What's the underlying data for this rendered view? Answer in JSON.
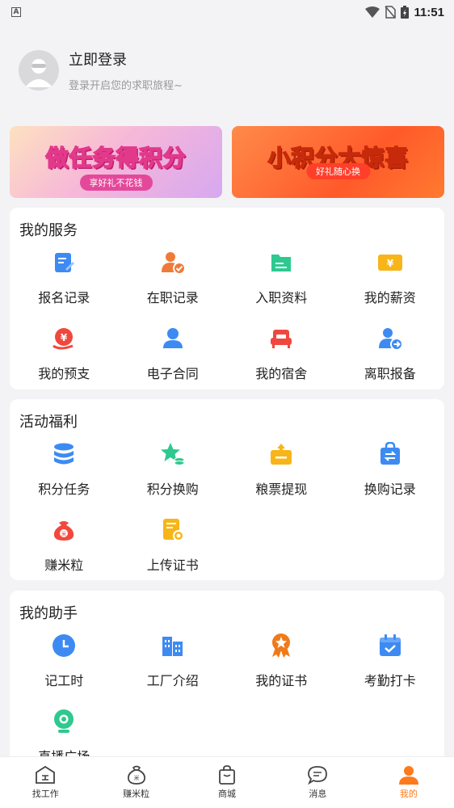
{
  "status_bar": {
    "time": "11:51",
    "left_icon_letter": "A"
  },
  "profile": {
    "title": "立即登录",
    "subtitle": "登录开启您的求职旅程~"
  },
  "banners": [
    {
      "title": "做任务得积分",
      "pill": "享好礼不花钱"
    },
    {
      "title": "小积分大惊喜",
      "pill": "好礼随心换"
    }
  ],
  "services": {
    "title": "我的服务",
    "items": [
      {
        "label": "报名记录",
        "icon": "signup-record-icon"
      },
      {
        "label": "在职记录",
        "icon": "employment-record-icon"
      },
      {
        "label": "入职资料",
        "icon": "onboarding-docs-icon"
      },
      {
        "label": "我的薪资",
        "icon": "salary-icon"
      },
      {
        "label": "我的预支",
        "icon": "advance-pay-icon"
      },
      {
        "label": "电子合同",
        "icon": "e-contract-icon"
      },
      {
        "label": "我的宿舍",
        "icon": "dorm-icon"
      },
      {
        "label": "离职报备",
        "icon": "resignation-icon"
      }
    ]
  },
  "welfare": {
    "title": "活动福利",
    "items": [
      {
        "label": "积分任务",
        "icon": "points-task-icon"
      },
      {
        "label": "积分换购",
        "icon": "points-exchange-icon"
      },
      {
        "label": "粮票提现",
        "icon": "voucher-withdraw-icon"
      },
      {
        "label": "换购记录",
        "icon": "exchange-record-icon"
      },
      {
        "label": "赚米粒",
        "icon": "earn-rice-icon"
      },
      {
        "label": "上传证书",
        "icon": "upload-certificate-icon"
      }
    ]
  },
  "assistant": {
    "title": "我的助手",
    "items": [
      {
        "label": "记工时",
        "icon": "clock-icon"
      },
      {
        "label": "工厂介绍",
        "icon": "factory-icon"
      },
      {
        "label": "我的证书",
        "icon": "certificate-icon"
      },
      {
        "label": "考勤打卡",
        "icon": "attendance-icon"
      },
      {
        "label": "直播广场",
        "icon": "live-plaza-icon"
      }
    ]
  },
  "tabbar": {
    "items": [
      {
        "label": "找工作",
        "icon": "find-job-icon"
      },
      {
        "label": "赚米粒",
        "icon": "earn-rice-tab-icon"
      },
      {
        "label": "商城",
        "icon": "mall-icon"
      },
      {
        "label": "消息",
        "icon": "message-icon"
      },
      {
        "label": "我的",
        "icon": "profile-tab-icon"
      }
    ],
    "active": "我的"
  },
  "colors": {
    "accent": "#ff7a1a",
    "blue": "#3d8bf2",
    "red": "#f0483e",
    "green": "#2ec98f",
    "yellow": "#f7b51a"
  }
}
